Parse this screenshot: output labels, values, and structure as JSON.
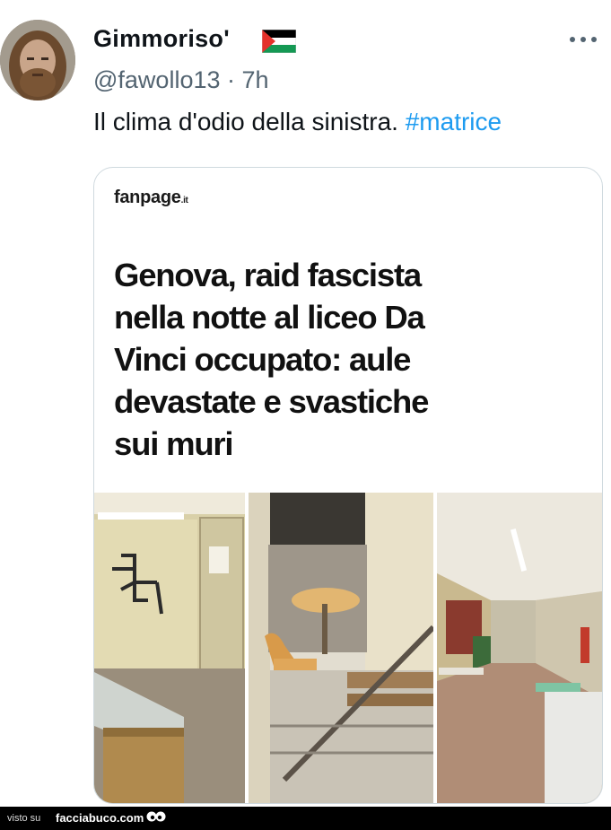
{
  "tweet": {
    "display_name": "Gimmoriso'",
    "flag_icon": "palestine-flag-icon",
    "handle": "@fawollo13",
    "separator": "·",
    "time": "7h",
    "text": "Il clima d'odio della sinistra.",
    "hashtag": "#matrice",
    "more_icon": "ellipsis-icon"
  },
  "card": {
    "source_logo": "fanpage",
    "source_logo_suffix": ".it",
    "headline": "Genova, raid fascista\nnella notte al liceo Da\nVinci occupato: aule\ndevastate e svastiche\nsui muri"
  },
  "footer": {
    "visto": "visto su",
    "site": "facciabuco.com"
  },
  "colors": {
    "hashtag": "#1d9bf0",
    "handle": "#536471",
    "text": "#0f1419"
  }
}
